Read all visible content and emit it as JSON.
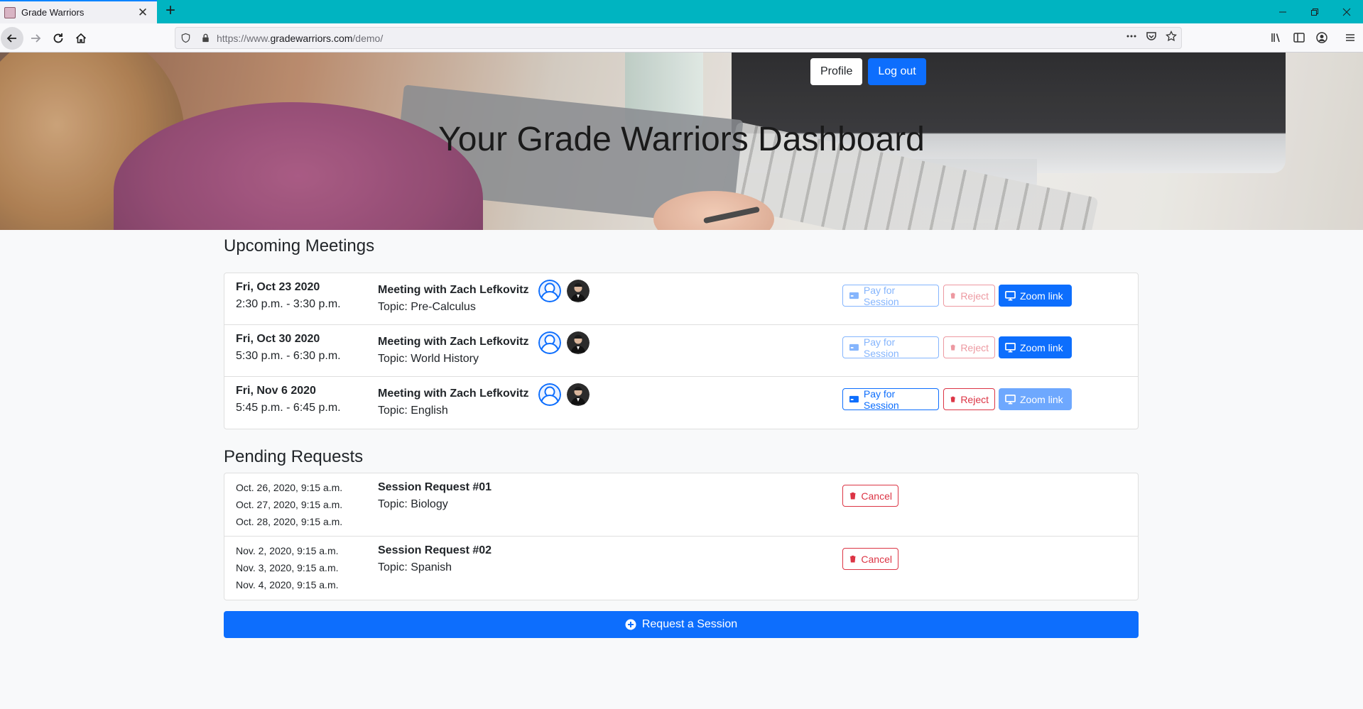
{
  "browser": {
    "tab_title": "Grade Warriors",
    "url_prefix": "https://www.",
    "url_domain": "gradewarriors.com",
    "url_path": "/demo/"
  },
  "header": {
    "profile_label": "Profile",
    "logout_label": "Log out",
    "title": "Your Grade Warriors Dashboard"
  },
  "upcoming": {
    "heading": "Upcoming Meetings",
    "pay_label": "Pay for Session",
    "reject_label": "Reject",
    "zoom_label": "Zoom link",
    "meetings": [
      {
        "date": "Fri, Oct 23 2020",
        "time": "2:30 p.m. - 3:30 p.m.",
        "title": "Meeting with Zach Lefkovitz",
        "topic": "Topic: Pre-Calculus"
      },
      {
        "date": "Fri, Oct 30 2020",
        "time": "5:30 p.m. - 6:30 p.m.",
        "title": "Meeting with Zach Lefkovitz",
        "topic": "Topic: World History"
      },
      {
        "date": "Fri, Nov 6 2020",
        "time": "5:45 p.m. - 6:45 p.m.",
        "title": "Meeting with Zach Lefkovitz",
        "topic": "Topic: English"
      }
    ]
  },
  "pending": {
    "heading": "Pending Requests",
    "cancel_label": "Cancel",
    "requests": [
      {
        "dates": [
          "Oct. 26, 2020, 9:15 a.m.",
          "Oct. 27, 2020, 9:15 a.m.",
          "Oct. 28, 2020, 9:15 a.m."
        ],
        "title": "Session Request #01",
        "topic": "Topic: Biology"
      },
      {
        "dates": [
          "Nov. 2, 2020, 9:15 a.m.",
          "Nov. 3, 2020, 9:15 a.m.",
          "Nov. 4, 2020, 9:15 a.m."
        ],
        "title": "Session Request #02",
        "topic": "Topic: Spanish"
      }
    ]
  },
  "request_button_label": "Request a Session",
  "colors": {
    "primary": "#0d6efd",
    "danger": "#dc3545",
    "tabbar": "#00b4c1"
  }
}
